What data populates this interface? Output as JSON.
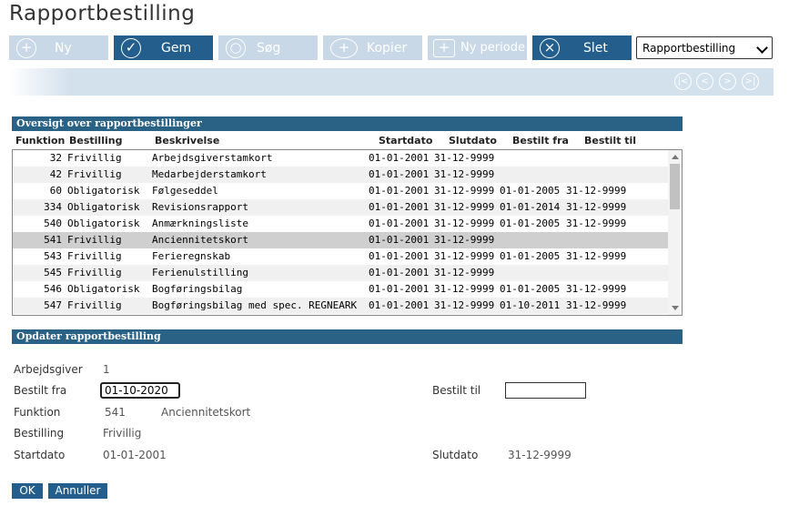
{
  "page": {
    "title": "Rapportbestilling"
  },
  "toolbar": {
    "buttons": [
      {
        "label": "Ny",
        "icon": "plus-icon",
        "enabled": false
      },
      {
        "label": "Gem",
        "icon": "check-icon",
        "enabled": true
      },
      {
        "label": "Søg",
        "icon": "search-icon",
        "enabled": false
      },
      {
        "label": "Kopier",
        "icon": "copy-icon",
        "enabled": false
      },
      {
        "label": "Ny periode",
        "icon": "new-period-icon",
        "enabled": false
      },
      {
        "label": "Slet",
        "icon": "delete-icon",
        "enabled": true
      }
    ],
    "select_value": "Rapportbestilling"
  },
  "overview": {
    "header": "Oversigt over rapportbestillinger",
    "columns": {
      "funktion": "Funktion",
      "bestilling": "Bestilling",
      "beskrivelse": "Beskrivelse",
      "startdato": "Startdato",
      "slutdato": "Slutdato",
      "bestilt_fra": "Bestilt fra",
      "bestilt_til": "Bestilt til"
    },
    "rows": [
      {
        "funktion": "32",
        "bestilling": "Frivillig",
        "beskrivelse": "Arbejdsgiverstamkort",
        "startdato": "01-01-2001",
        "slutdato": "31-12-9999",
        "bestilt_fra": "",
        "bestilt_til": ""
      },
      {
        "funktion": "42",
        "bestilling": "Frivillig",
        "beskrivelse": "Medarbejderstamkort",
        "startdato": "01-01-2001",
        "slutdato": "31-12-9999",
        "bestilt_fra": "",
        "bestilt_til": ""
      },
      {
        "funktion": "60",
        "bestilling": "Obligatorisk",
        "beskrivelse": "Følgeseddel",
        "startdato": "01-01-2001",
        "slutdato": "31-12-9999",
        "bestilt_fra": "01-01-2005",
        "bestilt_til": "31-12-9999"
      },
      {
        "funktion": "334",
        "bestilling": "Obligatorisk",
        "beskrivelse": "Revisionsrapport",
        "startdato": "01-01-2001",
        "slutdato": "31-12-9999",
        "bestilt_fra": "01-01-2014",
        "bestilt_til": "31-12-9999"
      },
      {
        "funktion": "540",
        "bestilling": "Obligatorisk",
        "beskrivelse": "Anmærkningsliste",
        "startdato": "01-01-2001",
        "slutdato": "31-12-9999",
        "bestilt_fra": "01-01-2005",
        "bestilt_til": "31-12-9999"
      },
      {
        "funktion": "541",
        "bestilling": "Frivillig",
        "beskrivelse": "Anciennitetskort",
        "startdato": "01-01-2001",
        "slutdato": "31-12-9999",
        "bestilt_fra": "",
        "bestilt_til": ""
      },
      {
        "funktion": "543",
        "bestilling": "Frivillig",
        "beskrivelse": "Ferieregnskab",
        "startdato": "01-01-2001",
        "slutdato": "31-12-9999",
        "bestilt_fra": "01-01-2005",
        "bestilt_til": "31-12-9999"
      },
      {
        "funktion": "545",
        "bestilling": "Frivillig",
        "beskrivelse": "Ferienulstilling",
        "startdato": "01-01-2001",
        "slutdato": "31-12-9999",
        "bestilt_fra": "",
        "bestilt_til": ""
      },
      {
        "funktion": "546",
        "bestilling": "Obligatorisk",
        "beskrivelse": "Bogføringsbilag",
        "startdato": "01-01-2001",
        "slutdato": "31-12-9999",
        "bestilt_fra": "01-01-2005",
        "bestilt_til": "31-12-9999"
      },
      {
        "funktion": "547",
        "bestilling": "Frivillig",
        "beskrivelse": "Bogføringsbilag med spec. REGNEARK",
        "startdato": "01-01-2001",
        "slutdato": "31-12-9999",
        "bestilt_fra": "01-10-2011",
        "bestilt_til": "31-12-9999"
      }
    ],
    "selected_index": 5
  },
  "form": {
    "header": "Opdater rapportbestilling",
    "arbejdsgiver_label": "Arbejdsgiver",
    "arbejdsgiver_value": "1",
    "bestilt_fra_label": "Bestilt fra",
    "bestilt_fra_value": "01-10-2020",
    "bestilt_til_label": "Bestilt til",
    "bestilt_til_value": "",
    "funktion_label": "Funktion",
    "funktion_value": "541",
    "funktion_desc": "Anciennitetskort",
    "bestilling_label": "Bestilling",
    "bestilling_value": "Frivillig",
    "startdato_label": "Startdato",
    "startdato_value": "01-01-2001",
    "slutdato_label": "Slutdato",
    "slutdato_value": "31-12-9999",
    "ok_label": "OK",
    "annuller_label": "Annuller"
  }
}
